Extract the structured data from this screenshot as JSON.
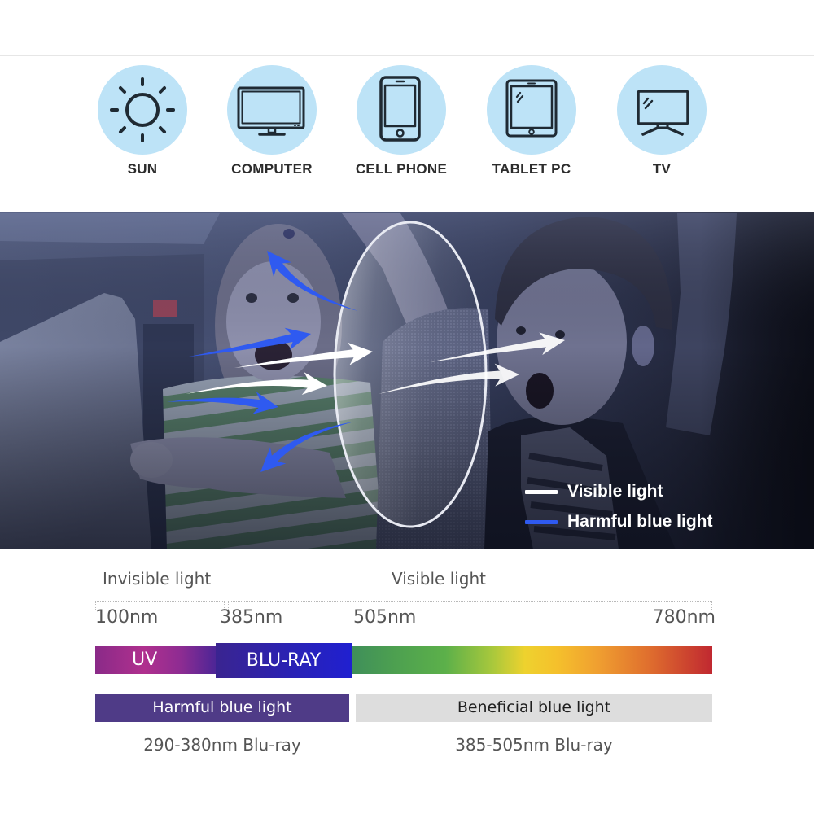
{
  "devices": [
    {
      "label": "SUN",
      "icon": "sun-icon"
    },
    {
      "label": "COMPUTER",
      "icon": "computer-monitor-icon"
    },
    {
      "label": "CELL PHONE",
      "icon": "cell-phone-icon"
    },
    {
      "label": "TABLET PC",
      "icon": "tablet-icon"
    },
    {
      "label": "TV",
      "icon": "tv-icon"
    }
  ],
  "photo": {
    "legend": [
      {
        "label": "Visible light",
        "color": "#ffffff"
      },
      {
        "label": "Harmful blue light",
        "color": "#2f5af0"
      }
    ]
  },
  "spectrum": {
    "regions": [
      {
        "label": "Invisible light"
      },
      {
        "label": "Visible light"
      }
    ],
    "ticks": [
      "100nm",
      "385nm",
      "505nm",
      "780nm"
    ],
    "bands": [
      {
        "label": "UV",
        "color_start": "#8a2a88",
        "color_end": "#4a2596"
      },
      {
        "label": "BLU-RAY",
        "color_start": "#3a2490",
        "color_end": "#2020d0"
      }
    ],
    "visible_gradient": [
      "#3f8f5a",
      "#5cb04a",
      "#a8c83c",
      "#eed22e",
      "#f0a030",
      "#e0702e",
      "#c02830"
    ]
  },
  "categories": [
    {
      "label": "Harmful blue light",
      "range": "290-380nm Blu-ray",
      "color": "#4f3b87"
    },
    {
      "label": "Beneficial blue light",
      "range": "385-505nm Blu-ray",
      "color": "#dddddd"
    }
  ],
  "colors": {
    "icon_circle": "#bde3f7",
    "icon_stroke": "#1f2a33",
    "harmful_blue": "#2f5af0"
  }
}
